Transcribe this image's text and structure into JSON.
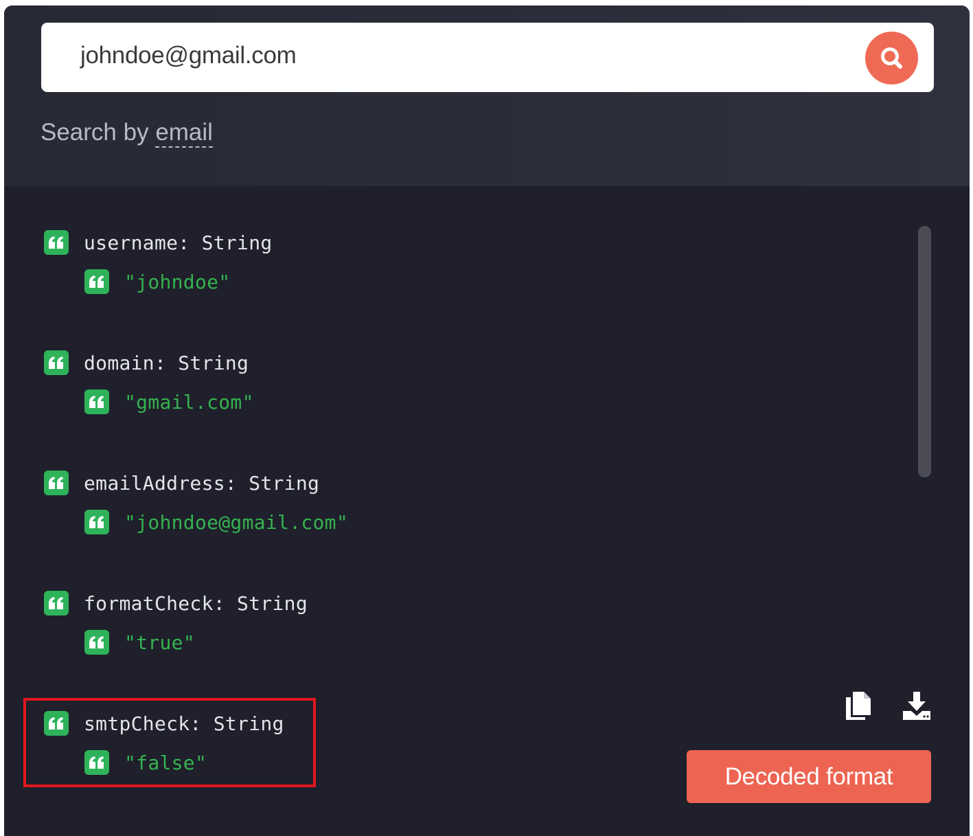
{
  "search": {
    "value": "johndoe@gmail.com",
    "label_prefix": "Search by ",
    "label_mode": "email",
    "button_icon": "search-icon"
  },
  "results": [
    {
      "key": "username: String",
      "value": "\"johndoe\""
    },
    {
      "key": "domain: String",
      "value": "\"gmail.com\""
    },
    {
      "key": "emailAddress: String",
      "value": "\"johndoe@gmail.com\""
    },
    {
      "key": "formatCheck: String",
      "value": "\"true\""
    },
    {
      "key": "smtpCheck: String",
      "value": "\"false\""
    }
  ],
  "actions": {
    "copy_icon": "copy-icon",
    "download_icon": "download-icon",
    "decoded_label": "Decoded format"
  },
  "colors": {
    "panel_bg": "#1f202b",
    "accent": "#ee6452",
    "value_green": "#35b24f",
    "highlight_red": "#e2171e"
  }
}
